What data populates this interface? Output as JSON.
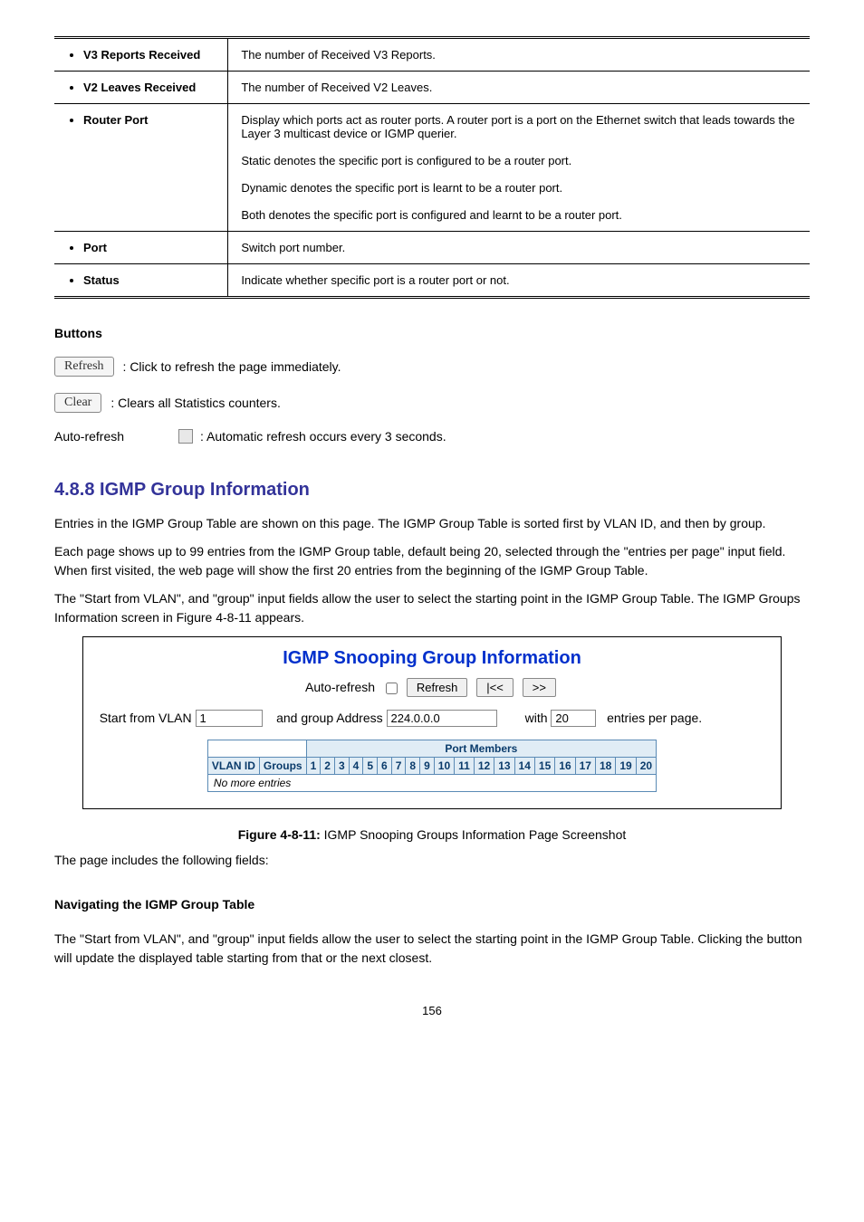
{
  "page_no": "156",
  "descTable": {
    "rows": [
      {
        "label": "V3 Reports Received",
        "desc": "The number of Received V3 Reports."
      },
      {
        "label": "V2 Leaves Received",
        "desc": "The number of Received V2 Leaves."
      },
      {
        "label": "Router Port",
        "desc": "Display which ports act as router ports. A router port is a port on the Ethernet switch that leads towards the Layer 3 multicast device or IGMP querier.\n\nStatic denotes the specific port is configured to be a router port.\n\nDynamic denotes the specific port is learnt to be a router port.\n\nBoth denotes the specific port is configured and learnt to be a router port."
      },
      {
        "label": "Port",
        "desc": "Switch port number."
      },
      {
        "label": "Status",
        "desc": "Indicate whether specific port is a router port or not."
      }
    ]
  },
  "buttons": {
    "heading": "Buttons",
    "refresh": {
      "label": "Refresh",
      "desc": ": Click to refresh the page immediately."
    },
    "clear": {
      "label": "Clear",
      "desc": ": Clears all Statistics counters."
    },
    "auto": {
      "prefix": "Auto-refresh",
      "desc": ": Automatic refresh occurs every 3 seconds."
    }
  },
  "section": {
    "title": "4.8.8 IGMP Group Information",
    "p1": "Entries in the IGMP Group Table are shown on this page. The IGMP Group Table is sorted first by VLAN ID, and then by group.",
    "p2": "Each page shows up to 99 entries from the IGMP Group table, default being 20, selected through the \"entries per page\" input field. When first visited, the web page will show the first 20 entries from the beginning of the IGMP Group Table.",
    "p3_a": "The \"Start from VLAN\", and \"group\" input fields allow the user to select the starting point in the IGMP Group Table. The IGMP Groups Information screen in ",
    "p3_link": "Figure 4-8-11",
    "p3_b": " appears."
  },
  "mockup": {
    "title": "IGMP Snooping Group Information",
    "autoLabel": "Auto-refresh",
    "btnRefresh": "Refresh",
    "btnPrev": "|<<",
    "btnNext": ">>",
    "startFrom": "Start from VLAN",
    "vlanVal": "1",
    "andGroup": "and group Address",
    "groupVal": "224.0.0.0",
    "with": "with",
    "perVal": "20",
    "epp": "entries per page.",
    "pmHeader": "Port Members",
    "col1": "VLAN ID",
    "col2": "Groups",
    "ports": [
      "1",
      "2",
      "3",
      "4",
      "5",
      "6",
      "7",
      "8",
      "9",
      "10",
      "11",
      "12",
      "13",
      "14",
      "15",
      "16",
      "17",
      "18",
      "19",
      "20"
    ],
    "noEntries": "No more entries"
  },
  "figCaption": {
    "bold": "Figure 4-8-11:",
    "rest": " IGMP Snooping Groups Information Page Screenshot"
  },
  "postText": "The page includes the following fields:",
  "navDesc": {
    "heading": "Navigating the IGMP Group Table",
    "text": "The \"Start from VLAN\", and \"group\" input fields allow the user to select the starting point in the IGMP Group Table. Clicking the button will update the displayed table starting from that or the next closest."
  }
}
